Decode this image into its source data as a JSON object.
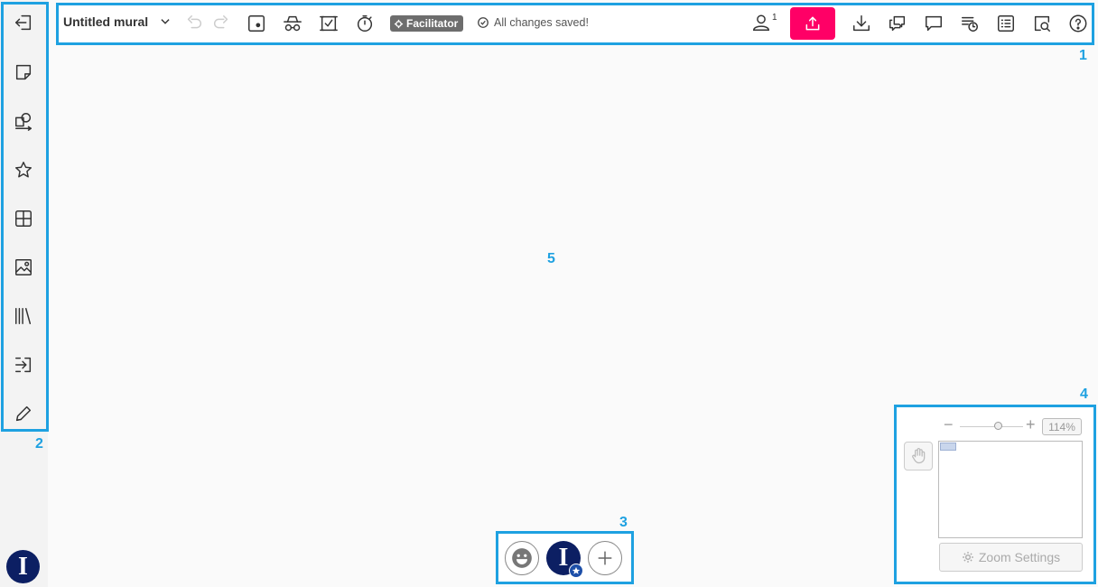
{
  "callouts": [
    "1",
    "2",
    "3",
    "4",
    "5"
  ],
  "toolbar": {
    "title": "Untitled mural",
    "facilitator_label": "Facilitator",
    "status_text": "All changes saved!",
    "user_count": "1",
    "icons": [
      "undo-icon",
      "redo-icon",
      "outline-icon",
      "private-mode-icon",
      "voting-icon",
      "timer-icon",
      "share-icon",
      "download-icon",
      "chat-icon",
      "comment-icon",
      "activity-icon",
      "outline-list-icon",
      "search-icon",
      "help-icon"
    ]
  },
  "sidebar": {
    "icons": [
      "exit-icon",
      "sticky-note-icon",
      "shapes-icon",
      "favorite-icon",
      "frameworks-icon",
      "image-icon",
      "library-icon",
      "import-icon",
      "draw-icon"
    ],
    "avatar_initial": "I"
  },
  "bottom": {
    "avatar_initial": "I"
  },
  "navigator": {
    "zoom_minus": "−",
    "zoom_plus": "+",
    "zoom_level": "114%",
    "zoom_fraction": 0.6,
    "settings_label": "Zoom Settings"
  },
  "colors": {
    "accent": "#ff0066",
    "callout": "#1ea1e1",
    "avatar": "#0c1f63"
  }
}
